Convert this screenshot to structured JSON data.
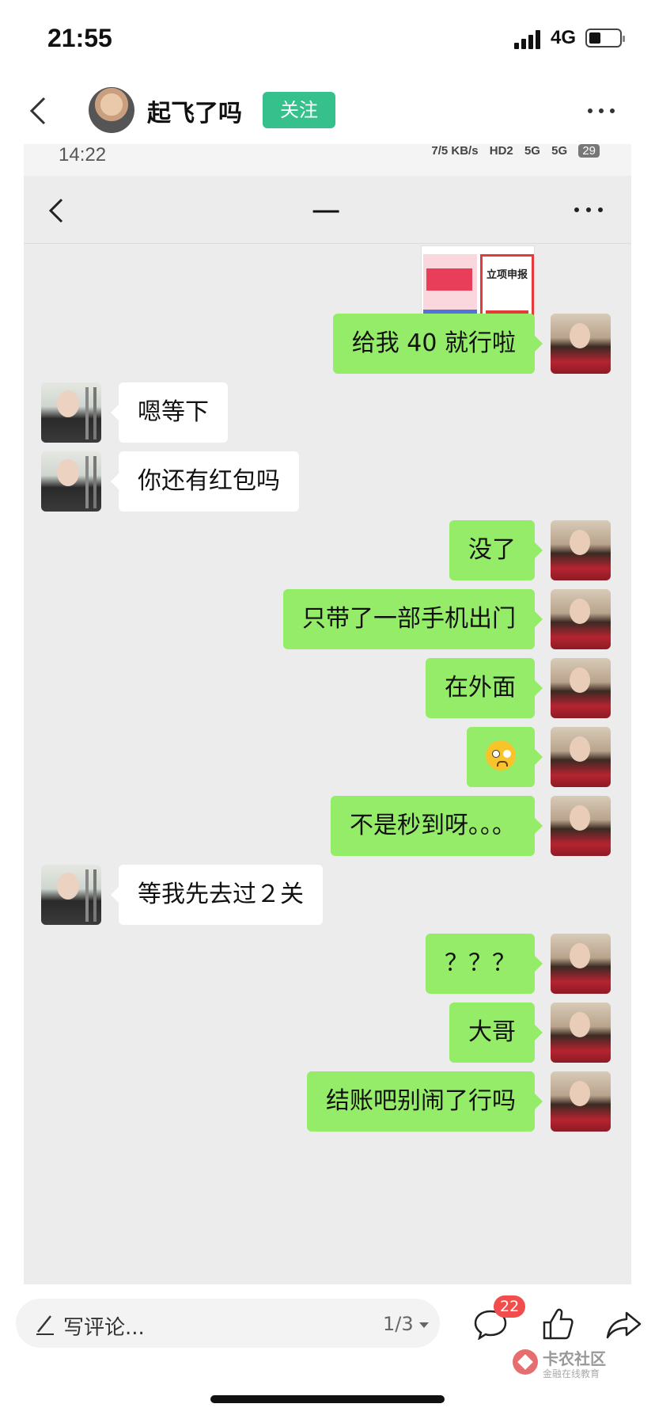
{
  "status_bar": {
    "time": "21:55",
    "network": "4G"
  },
  "post": {
    "author": "起飞了吗",
    "follow_label": "关注"
  },
  "inner_screenshot": {
    "status": {
      "time": "14:22",
      "speed": "7/5 KB/s",
      "hd": "HD2",
      "sig1": "5G",
      "sig2": "5G",
      "battery": "29"
    },
    "chat_title": "一",
    "image_card": {
      "right_title": "立项申报"
    },
    "messages": [
      {
        "side": "me",
        "text": "给我 40 就行啦"
      },
      {
        "side": "other",
        "text": "嗯等下"
      },
      {
        "side": "other",
        "text": "你还有红包吗"
      },
      {
        "side": "me",
        "text": "没了"
      },
      {
        "side": "me",
        "text": "只带了一部手机出门"
      },
      {
        "side": "me",
        "text": "在外面"
      },
      {
        "side": "me",
        "text": "",
        "emoji": "pleading-face-emoji"
      },
      {
        "side": "me",
        "text": "不是秒到呀。。。"
      },
      {
        "side": "other",
        "text": "等我先去过２关"
      },
      {
        "side": "me",
        "text": "？？？"
      },
      {
        "side": "me",
        "text": "大哥"
      },
      {
        "side": "me",
        "text": "结账吧别闹了行吗"
      }
    ]
  },
  "comment_bar": {
    "placeholder": "写评论...",
    "page_indicator": "1/3",
    "comment_count": "22"
  },
  "watermark": {
    "title": "卡农社区",
    "subtitle": "金融在线教育"
  },
  "colors": {
    "accent": "#36c08c",
    "bubble_me": "#95ec69",
    "bubble_other": "#ffffff",
    "badge": "#f24d4d"
  }
}
